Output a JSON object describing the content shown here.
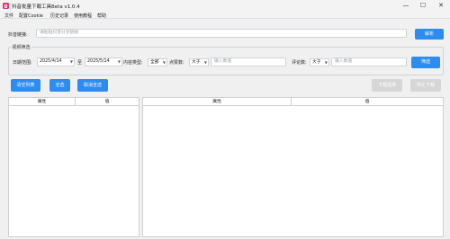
{
  "window": {
    "title": "抖音批量下载工具Beta v1.0.4",
    "minimize": "—",
    "maximize": "☐",
    "close": "✕"
  },
  "menu": [
    "文件",
    "配置Cookie",
    "历史记录",
    "使用教程",
    "帮助"
  ],
  "link": {
    "label": "抖音链接:",
    "placeholder": "请粘贴抖音分享链接",
    "parse_button": "解析"
  },
  "filter": {
    "group_title": "视频筛选",
    "date_range_label": "日期范围:",
    "date_from": "2025/4/14",
    "to_label": "至",
    "date_to": "2025/5/14",
    "content_type_label": "内容类型:",
    "content_type_value": "全部",
    "likes_label": "点赞数:",
    "likes_op": "大于",
    "likes_placeholder": "输入数值",
    "comments_label": "评论数:",
    "comments_op": "大于",
    "comments_placeholder": "输入数值",
    "filter_button": "筛选"
  },
  "actions": {
    "clear_list": "清空列表",
    "select_all": "全选",
    "deselect_all": "取消全选",
    "download_selected": "下载选择",
    "stop_download": "停止下载"
  },
  "left_table": {
    "columns": [
      "属性",
      "值"
    ]
  },
  "right_table": {
    "columns": [
      "属性",
      "值"
    ]
  },
  "colors": {
    "accent": "#2d8cf0",
    "app_icon": "#e8356a",
    "disabled": "#d6d6d6"
  }
}
